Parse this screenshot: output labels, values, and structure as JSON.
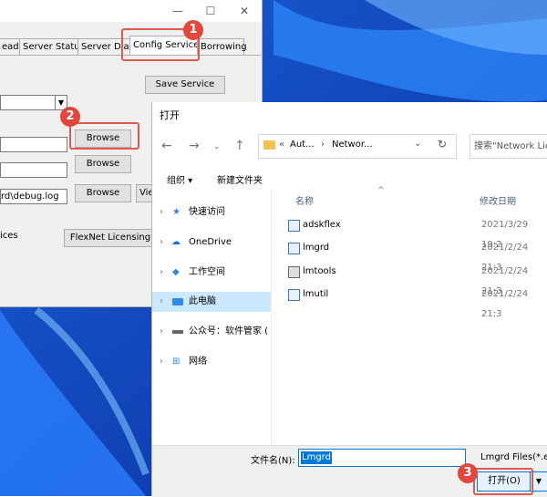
{
  "lmtools": {
    "tabs": [
      "ead",
      "Server Status",
      "Server Diags",
      "Config Services",
      "Borrowing"
    ],
    "save_service": "Save Service",
    "browse1": "Browse",
    "browse2": "Browse",
    "browse3": "Browse",
    "view_partial": "View",
    "debug_path": "rd\\debug.log",
    "ices_label": "ices",
    "flexnet_btn": "FlexNet Licensing",
    "min_glyph": "—",
    "max_glyph": "☐",
    "close_glyph": "✕"
  },
  "badges": [
    "1",
    "2",
    "3"
  ],
  "accent": "#e2463c",
  "dialog": {
    "title": "打开",
    "address": {
      "prefix": "«",
      "seg1": "Aut...",
      "sep": "›",
      "seg2": "Networ..."
    },
    "search_placeholder": "搜索\"Network Lic",
    "organize": "组织 ▾",
    "new_folder": "新建文件夹",
    "nav_items": [
      "快速访问",
      "OneDrive",
      "工作空间",
      "此电脑",
      "公众号：软件管家 (",
      "网络"
    ],
    "col_name": "名称",
    "col_date": "修改日期",
    "files": [
      {
        "name": "adskflex",
        "date": "2021/3/29 19:2"
      },
      {
        "name": "lmgrd",
        "date": "2021/2/24 21:3"
      },
      {
        "name": "lmtools",
        "date": "2021/2/24 21:3"
      },
      {
        "name": "lmutil",
        "date": "2021/2/24 21:3"
      }
    ],
    "filename_label": "文件名(N):",
    "filename_value": "Lmgrd",
    "filter": "Lmgrd Files(*.ex",
    "open_button": "打开(O)"
  }
}
